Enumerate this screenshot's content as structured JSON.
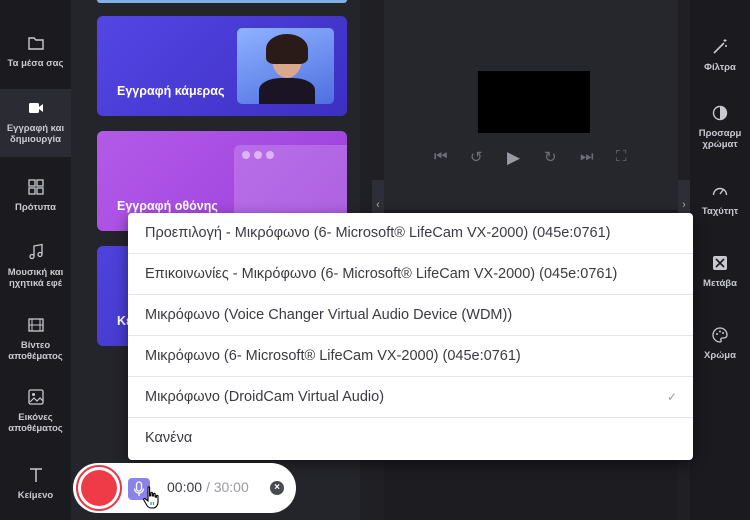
{
  "sidebar": {
    "items": [
      {
        "label": "Τα μέσα σας",
        "icon": "folder-icon"
      },
      {
        "label": "Εγγραφή και δημιουργία",
        "icon": "camera-icon"
      },
      {
        "label": "Πρότυπα",
        "icon": "templates-icon"
      },
      {
        "label": "Μουσική και ηχητικά εφέ",
        "icon": "music-icon"
      },
      {
        "label": "Βίντεο αποθέματος",
        "icon": "film-icon"
      },
      {
        "label": "Εικόνες αποθέματος",
        "icon": "image-icon"
      },
      {
        "label": "Κείμενο",
        "icon": "text-icon"
      }
    ]
  },
  "panel": {
    "camera_card_label": "Εγγραφή κάμερας",
    "screen_card_label": "Εγγραφή οθόνης",
    "third_card_label": "Κε"
  },
  "right_sidebar": {
    "items": [
      {
        "label": "Φίλτρα",
        "icon": "magic-wand-icon"
      },
      {
        "label": "Προσαρμ χρώματ",
        "icon": "contrast-icon"
      },
      {
        "label": "Ταχύτητ",
        "icon": "speedometer-icon"
      },
      {
        "label": "Μετάβα",
        "icon": "transition-icon"
      },
      {
        "label": "Χρώμα",
        "icon": "palette-icon"
      }
    ]
  },
  "microphone_menu": {
    "options": [
      "Προεπιλογή - Μικρόφωνο (6- Microsoft® LifeCam VX-2000) (045e:0761)",
      "Επικοινωνίες - Μικρόφωνο (6- Microsoft® LifeCam VX-2000) (045e:0761)",
      "Μικρόφωνο (Voice Changer Virtual Audio Device (WDM))",
      "Μικρόφωνο (6- Microsoft® LifeCam VX-2000) (045e:0761)",
      "Μικρόφωνο (DroidCam Virtual Audio)",
      "Κανένα"
    ],
    "selected_index": 4,
    "check_mark": "✓"
  },
  "recorder": {
    "elapsed": "00:00",
    "separator": "/",
    "limit": "30:00"
  },
  "colors": {
    "record_red": "#ef3b47",
    "mic_button": "#8b83e8",
    "card_blue": "#4b3fd6",
    "card_purple": "#a349e6"
  }
}
